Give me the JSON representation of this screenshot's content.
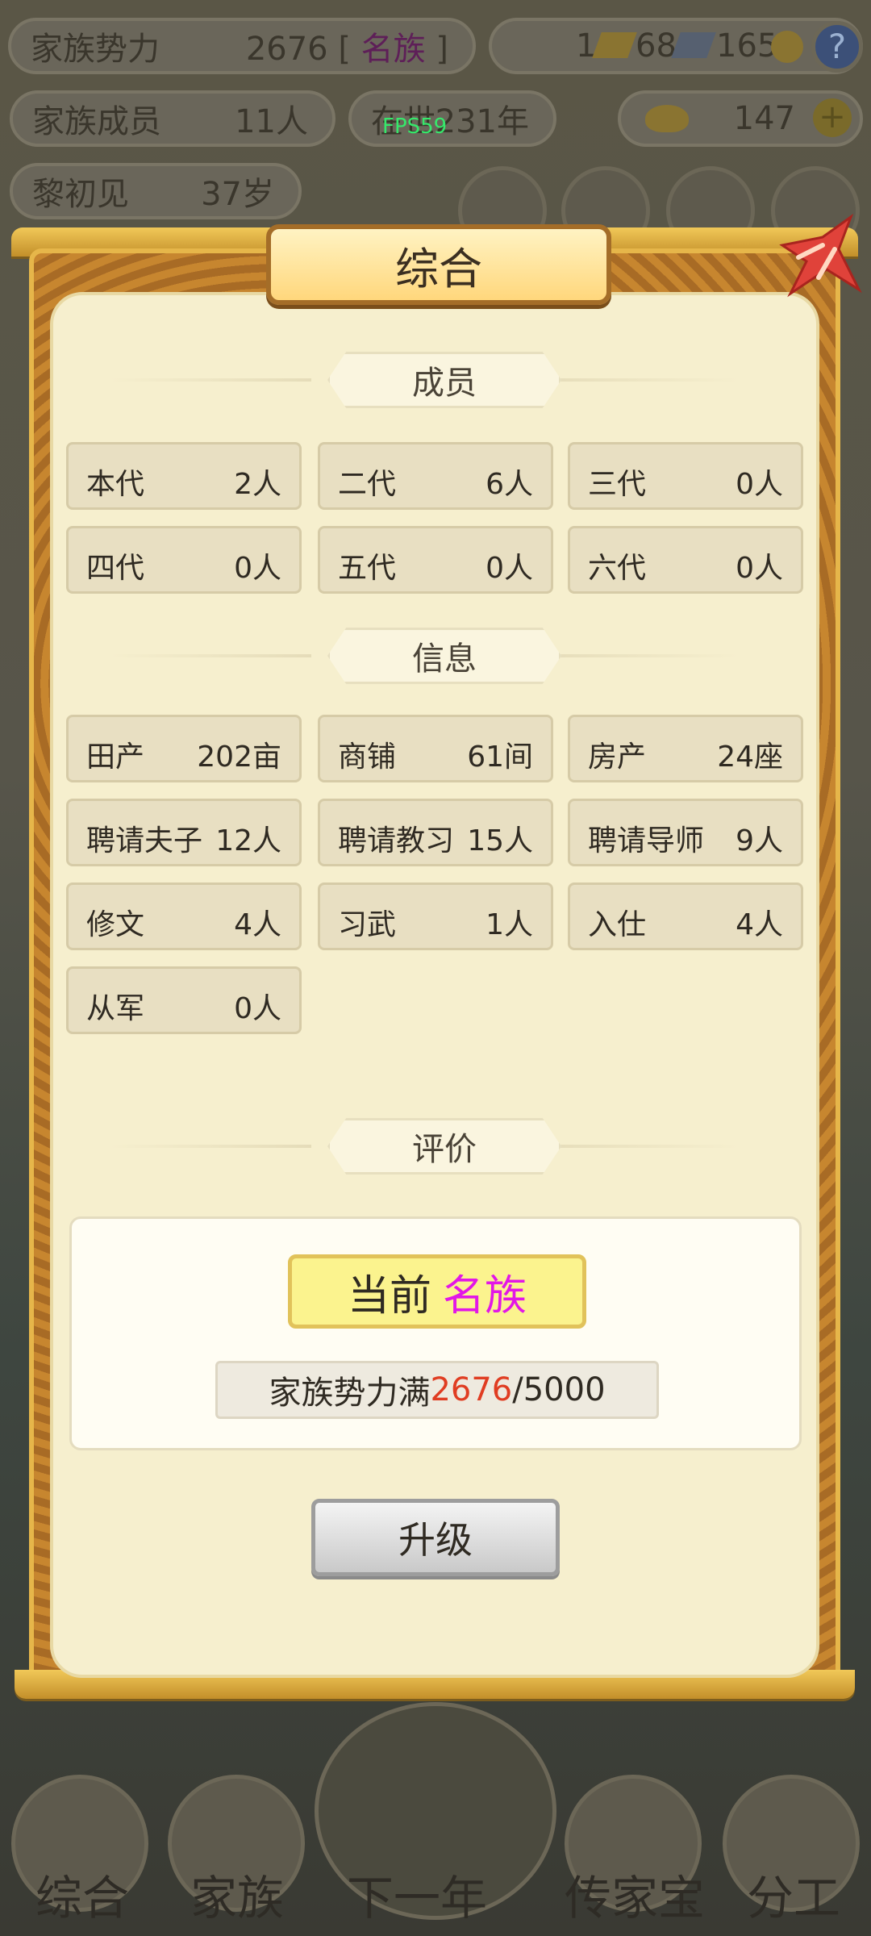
{
  "hud": {
    "family_power_label": "家族势力",
    "family_power_value": "2676",
    "family_rank_bracket_open": "[",
    "family_rank_name": "名族",
    "family_rank_bracket_close": "]",
    "currency_1": "1",
    "currency_2": "68",
    "currency_3": "165",
    "help": "?",
    "members_label": "家族成员",
    "members_value": "11人",
    "era_label": "在世",
    "era_value": "231年",
    "gold_value": "147",
    "add": "+",
    "person_name": "黎初见",
    "person_age": "37岁",
    "fps": "FPS59"
  },
  "modal": {
    "title": "综合",
    "sections": {
      "members": "成员",
      "info": "信息",
      "rating": "评价"
    },
    "members": [
      {
        "k": "本代",
        "v": "2人"
      },
      {
        "k": "二代",
        "v": "6人"
      },
      {
        "k": "三代",
        "v": "0人"
      },
      {
        "k": "四代",
        "v": "0人"
      },
      {
        "k": "五代",
        "v": "0人"
      },
      {
        "k": "六代",
        "v": "0人"
      }
    ],
    "info": [
      {
        "k": "田产",
        "v": "202亩"
      },
      {
        "k": "商铺",
        "v": "61间"
      },
      {
        "k": "房产",
        "v": "24座"
      },
      {
        "k": "聘请夫子",
        "v": "12人"
      },
      {
        "k": "聘请教习",
        "v": "15人"
      },
      {
        "k": "聘请导师",
        "v": "9人"
      },
      {
        "k": "修文",
        "v": "4人"
      },
      {
        "k": "习武",
        "v": "1人"
      },
      {
        "k": "入仕",
        "v": "4人"
      },
      {
        "k": "从军",
        "v": "0人"
      }
    ],
    "rating": {
      "current_label": "当前",
      "current_rank": "名族",
      "progress_prefix": "家族势力满",
      "progress_current": "2676",
      "progress_sep": "/",
      "progress_target": "5000"
    },
    "upgrade_button": "升级",
    "colors": {
      "rank_magenta": "#e217e7",
      "progress_red": "#e03d22",
      "gold_frame": "#e6b64a"
    }
  },
  "bottom_nav": [
    "综合",
    "家族",
    "下一年",
    "传家宝",
    "分工"
  ]
}
